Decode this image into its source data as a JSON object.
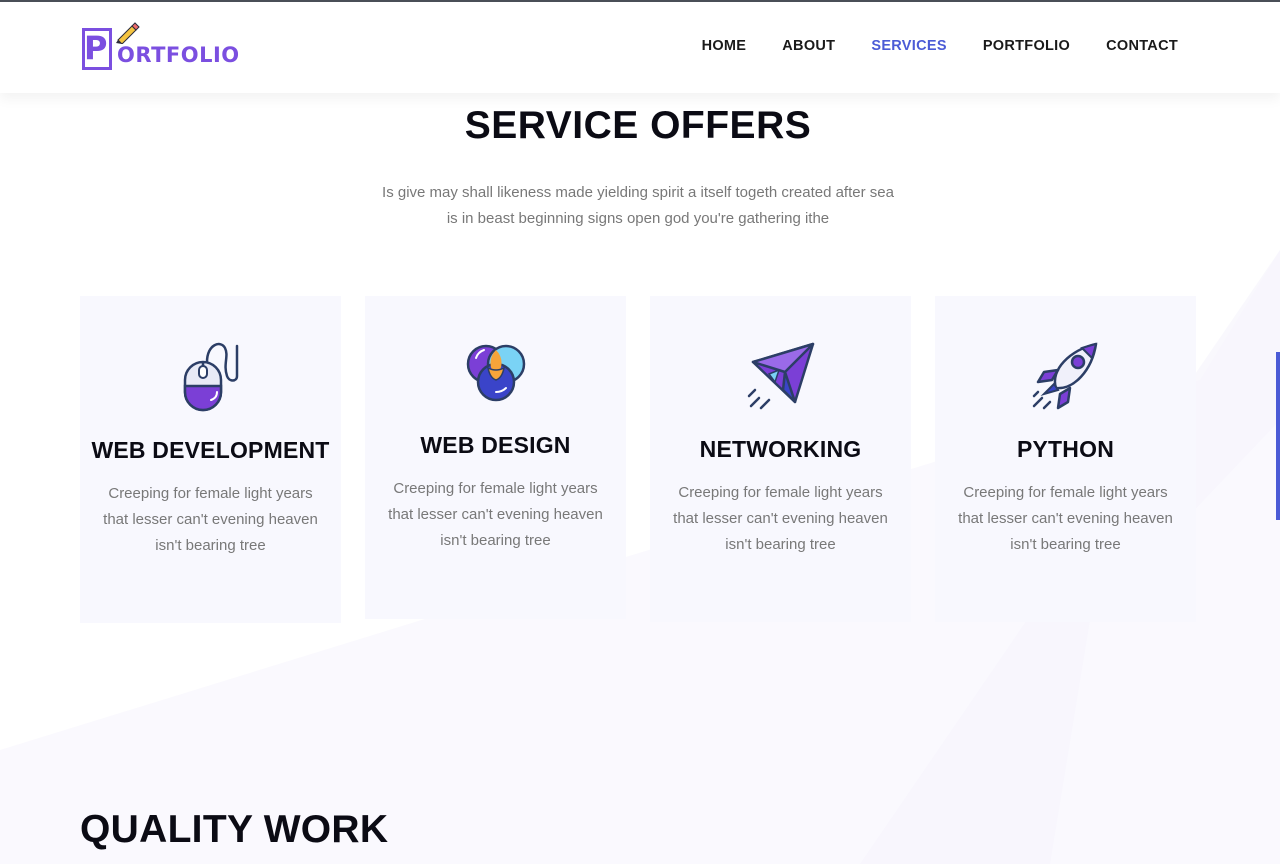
{
  "brand": {
    "logo_letter": "P",
    "logo_text": "ORTFOLIO"
  },
  "nav": [
    {
      "label": "HOME",
      "active": false
    },
    {
      "label": "ABOUT",
      "active": false
    },
    {
      "label": "SERVICES",
      "active": true
    },
    {
      "label": "PORTFOLIO",
      "active": false
    },
    {
      "label": "CONTACT",
      "active": false
    }
  ],
  "services": {
    "title": "SERVICE OFFERS",
    "subtitle_line1": "Is give may shall likeness made yielding spirit a itself togeth created after sea",
    "subtitle_line2": "is in beast beginning signs open god you're gathering ithe",
    "cards": [
      {
        "title": "WEB DEVELOPMENT",
        "icon": "mouse-icon",
        "line1": "Creeping for female light years",
        "line2": "that lesser can't evening heaven",
        "line3": "isn't bearing tree"
      },
      {
        "title": "WEB DESIGN",
        "icon": "color-circles-icon",
        "line1": "Creeping for female light years",
        "line2": "that lesser can't evening heaven",
        "line3": "isn't bearing tree"
      },
      {
        "title": "NETWORKING",
        "icon": "paper-plane-icon",
        "line1": "Creeping for female light years",
        "line2": "that lesser can't evening heaven",
        "line3": "isn't bearing tree"
      },
      {
        "title": "PYTHON",
        "icon": "rocket-icon",
        "line1": "Creeping for female light years",
        "line2": "that lesser can't evening heaven",
        "line3": "isn't bearing tree"
      }
    ]
  },
  "quality": {
    "title": "QUALITY WORK"
  },
  "colors": {
    "accent": "#4b5bd6",
    "brand": "#7b4fe0",
    "card_bg": "#f8f8fe",
    "text_muted": "#787878"
  }
}
